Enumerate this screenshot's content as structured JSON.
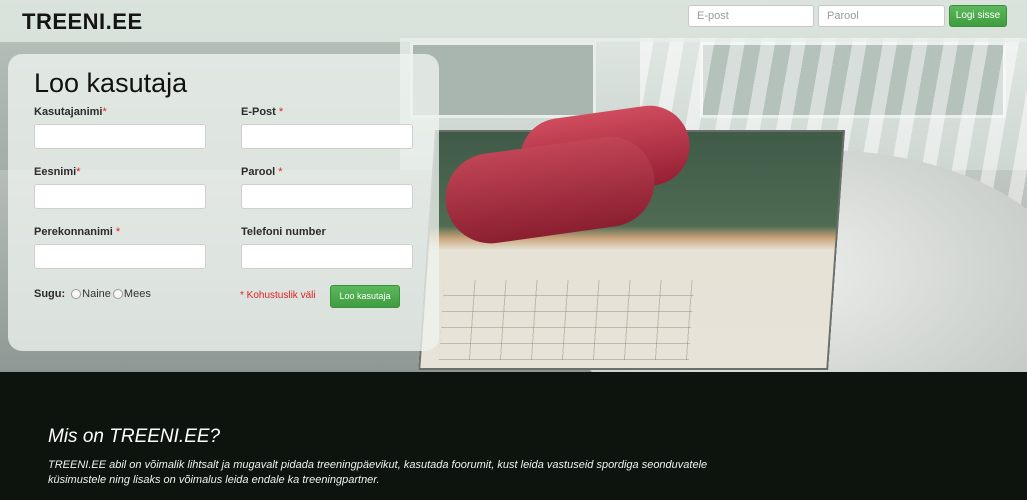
{
  "header": {
    "logo": "TREENI.EE",
    "email_placeholder": "E-post",
    "password_placeholder": "Parool",
    "login_label": "Logi sisse"
  },
  "register": {
    "title": "Loo kasutaja",
    "username_label": "Kasutajanimi",
    "email_label": "E-Post ",
    "firstname_label": "Eesnimi",
    "password_label": "Parool ",
    "lastname_label": "Perekonnanimi ",
    "phone_label": "Telefoni number",
    "required_mark": "*",
    "gender_label": "Sugu:",
    "gender_options": [
      "Naine",
      "Mees"
    ],
    "required_note": "* Kohustuslik väli",
    "submit_label": "Loo kasutaja"
  },
  "info": {
    "title": "Mis on TREENI.EE?",
    "text": "TREENI.EE abil on võimalik lihtsalt ja mugavalt pidada treeningpäevikut, kasutada foorumit, kust leida vastuseid spordiga seonduvatele küsimustele ning lisaks on võimalus leida endale ka treeningpartner."
  }
}
